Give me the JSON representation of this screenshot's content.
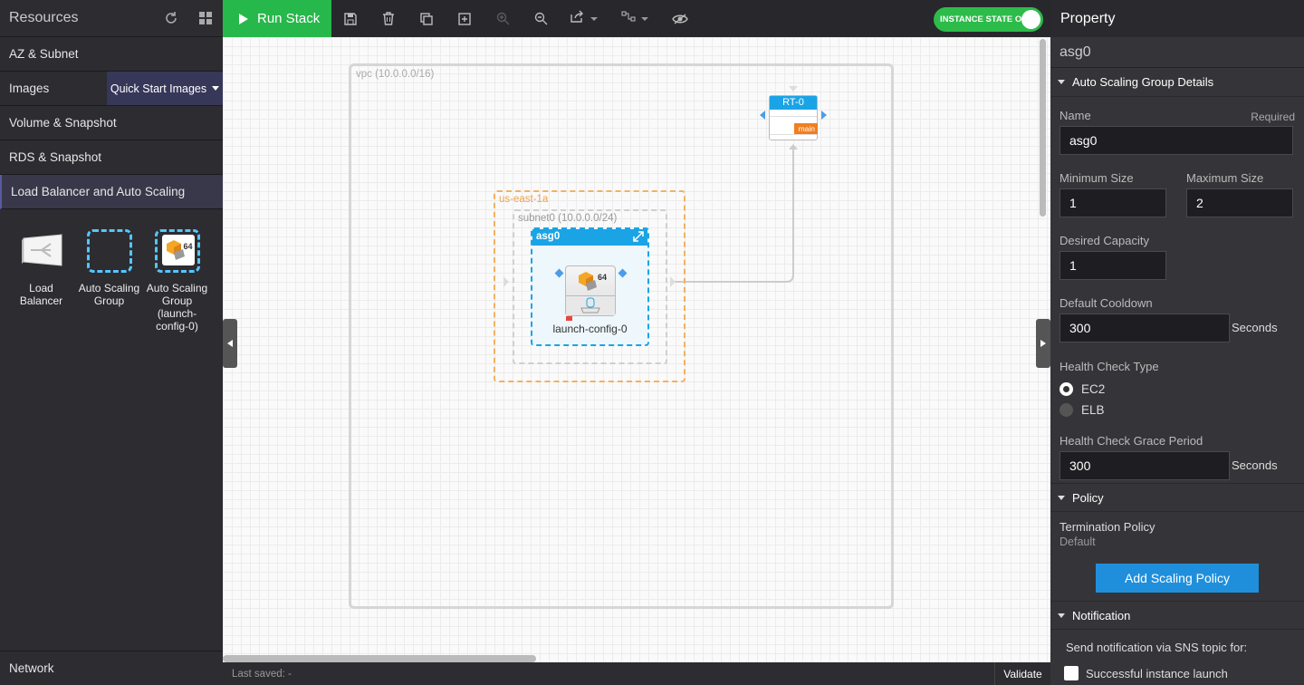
{
  "left": {
    "title": "Resources",
    "sections": [
      {
        "label": "AZ & Subnet"
      },
      {
        "label": "Images",
        "dropdown": "Quick Start Images"
      },
      {
        "label": "Volume & Snapshot"
      },
      {
        "label": "RDS & Snapshot"
      },
      {
        "label": "Load Balancer and Auto Scaling"
      }
    ],
    "resources": [
      {
        "label": "Load Balancer",
        "icon": "load-balancer-icon"
      },
      {
        "label": "Auto Scaling Group",
        "icon": "auto-scaling-group-icon"
      },
      {
        "label": "Auto Scaling Group (launch-config-0)",
        "icon": "launch-config-icon",
        "badge": "64"
      }
    ],
    "footer": "Network"
  },
  "toolbar": {
    "run_label": "Run Stack",
    "instance_state": "INSTANCE STATE ON",
    "icons": [
      "save-icon",
      "delete-icon",
      "duplicate-icon",
      "new-icon",
      "zoom-in-icon",
      "zoom-out-icon",
      "export-icon",
      "line-style-icon",
      "visibility-icon"
    ]
  },
  "canvas": {
    "vpc_label": "vpc (10.0.0.0/16)",
    "az_label": "us-east-1a",
    "subnet_label": "subnet0 (10.0.0.0/24)",
    "asg_label": "asg0",
    "lc_label": "launch-config-0",
    "lc_badge": "64",
    "rt_label": "RT-0",
    "rt_tag": "main"
  },
  "status": {
    "last_saved": "Last saved: -",
    "validate": "Validate"
  },
  "property": {
    "title": "Property",
    "name_value": "asg0",
    "group1": "Auto Scaling Group Details",
    "name_label": "Name",
    "required": "Required",
    "name_input": "asg0",
    "min_label": "Minimum Size",
    "min_value": "1",
    "max_label": "Maximum Size",
    "max_value": "2",
    "desired_label": "Desired Capacity",
    "desired_value": "1",
    "cooldown_label": "Default Cooldown",
    "cooldown_value": "300",
    "seconds": "Seconds",
    "hc_label": "Health Check Type",
    "hc_ec2": "EC2",
    "hc_elb": "ELB",
    "grace_label": "Health Check Grace Period",
    "grace_value": "300",
    "group2": "Policy",
    "term_label": "Termination Policy",
    "term_value": "Default",
    "add_policy": "Add Scaling Policy",
    "group3": "Notification",
    "notif_text": "Send notification via SNS topic for:",
    "notif_item": "Successful instance launch"
  }
}
